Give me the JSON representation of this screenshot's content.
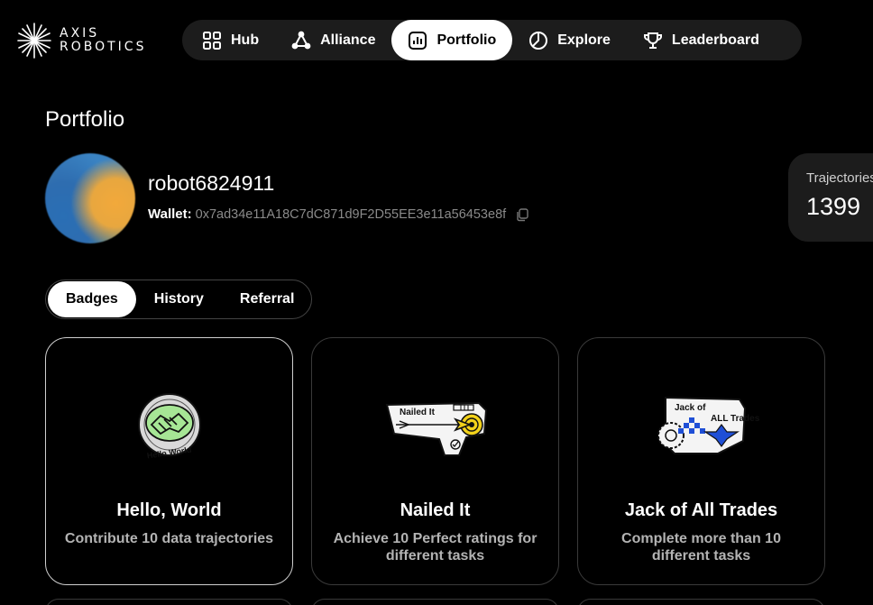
{
  "logo": {
    "line1": "AXIS",
    "line2": "ROBOTICS"
  },
  "nav": [
    {
      "label": "Hub",
      "icon": "grid-icon",
      "active": false
    },
    {
      "label": "Alliance",
      "icon": "network-icon",
      "active": false
    },
    {
      "label": "Portfolio",
      "icon": "bar-chart-icon",
      "active": true
    },
    {
      "label": "Explore",
      "icon": "pie-chart-icon",
      "active": false
    },
    {
      "label": "Leaderboard",
      "icon": "trophy-icon",
      "active": false
    }
  ],
  "page_title": "Portfolio",
  "profile": {
    "username": "robot6824911",
    "wallet_label": "Wallet:",
    "wallet_address": "0x7ad34e11A18C7dC871d9F2D55EE3e11a56453e8f"
  },
  "stat": {
    "label": "Trajectories",
    "value": "1399"
  },
  "tabs": [
    {
      "label": "Badges",
      "active": true
    },
    {
      "label": "History",
      "active": false
    },
    {
      "label": "Referral",
      "active": false
    }
  ],
  "badges": [
    {
      "title": "Hello, World",
      "desc": "Contribute 10 data trajectories",
      "art_text": "Hello World",
      "selected": true
    },
    {
      "title": "Nailed It",
      "desc": "Achieve 10 Perfect ratings for different tasks",
      "art_text": "Nailed It",
      "selected": false
    },
    {
      "title": "Jack of All Trades",
      "desc": "Complete more than 10 different tasks",
      "art_text": "Jack of All Trades",
      "selected": false
    }
  ],
  "colors": {
    "background": "#000000",
    "nav_bg": "#1c1c1c",
    "accent_yellow": "#f2d21b",
    "accent_blue": "#1f4fd6",
    "accent_green": "#9be08c"
  }
}
